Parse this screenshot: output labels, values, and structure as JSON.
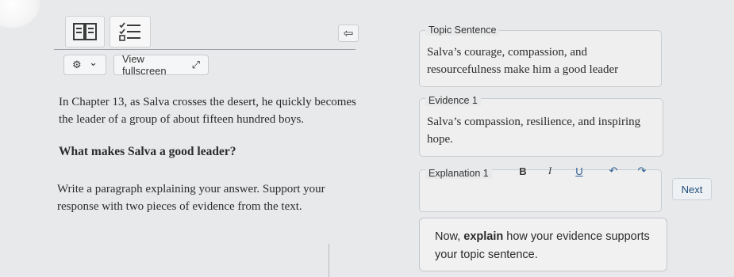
{
  "toolbar": {
    "view_fullscreen_label": "View fullscreen",
    "view_fullscreen_glyph": "⤢",
    "gear_glyph": "⚙",
    "chevron_glyph": "⌄",
    "back_glyph": "⇦",
    "book_icon": "book-icon",
    "list_icon": "checklist-icon"
  },
  "passage": {
    "paragraph": "In Chapter 13, as Salva crosses the desert, he quickly becomes the leader of a group of about fifteen hundred boys.",
    "line1": "In Chapter 13, as Salva crosses the desert, he quickly becomes",
    "line2": "the leader of a group of about fifteen hundred boys.",
    "question": "What makes Salva a good leader?",
    "prompt_line1": "Write a paragraph explaining your answer. Support your",
    "prompt_line2": "response with two pieces of evidence from the text."
  },
  "topic_sentence": {
    "label": "Topic Sentence",
    "line1": "Salva’s courage, compassion, and",
    "line2": "resourcefulness make him a good leader"
  },
  "evidence1": {
    "label": "Evidence 1",
    "line1": "Salva’s compassion, resilience, and inspiring",
    "line2": "hope."
  },
  "explanation1": {
    "label": "Explanation 1",
    "bold": "B",
    "italic": "I",
    "underline": "U",
    "undo": "↶",
    "redo": "↷"
  },
  "next_button": "Next",
  "explain_prompt": {
    "prefix": "Now, ",
    "bold_word": "explain",
    "suffix": " how your evidence supports",
    "line2": "your topic sentence."
  },
  "colors": {
    "background": "#e8e9ea",
    "card_border": "#c9ccd0",
    "link_blue": "#1f4d7a"
  }
}
